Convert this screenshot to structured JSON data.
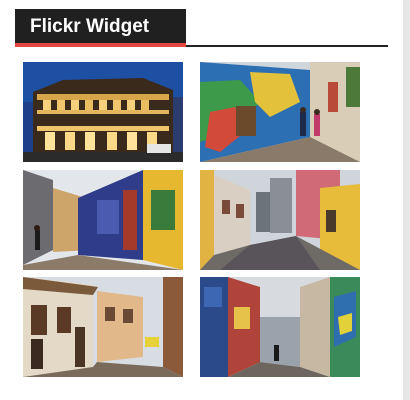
{
  "widget": {
    "title": "Flickr Widget",
    "accent_color": "#e1473f",
    "title_bg": "#202020"
  },
  "photos": [
    {
      "id": "photo-1",
      "subject": "colonial-building-at-dusk"
    },
    {
      "id": "photo-2",
      "subject": "mural-alley-with-people"
    },
    {
      "id": "photo-3",
      "subject": "colorful-colonial-street"
    },
    {
      "id": "photo-4",
      "subject": "street-with-tall-buildings"
    },
    {
      "id": "photo-5",
      "subject": "old-town-street-with-balconies"
    },
    {
      "id": "photo-6",
      "subject": "narrow-alley-with-murals"
    }
  ]
}
